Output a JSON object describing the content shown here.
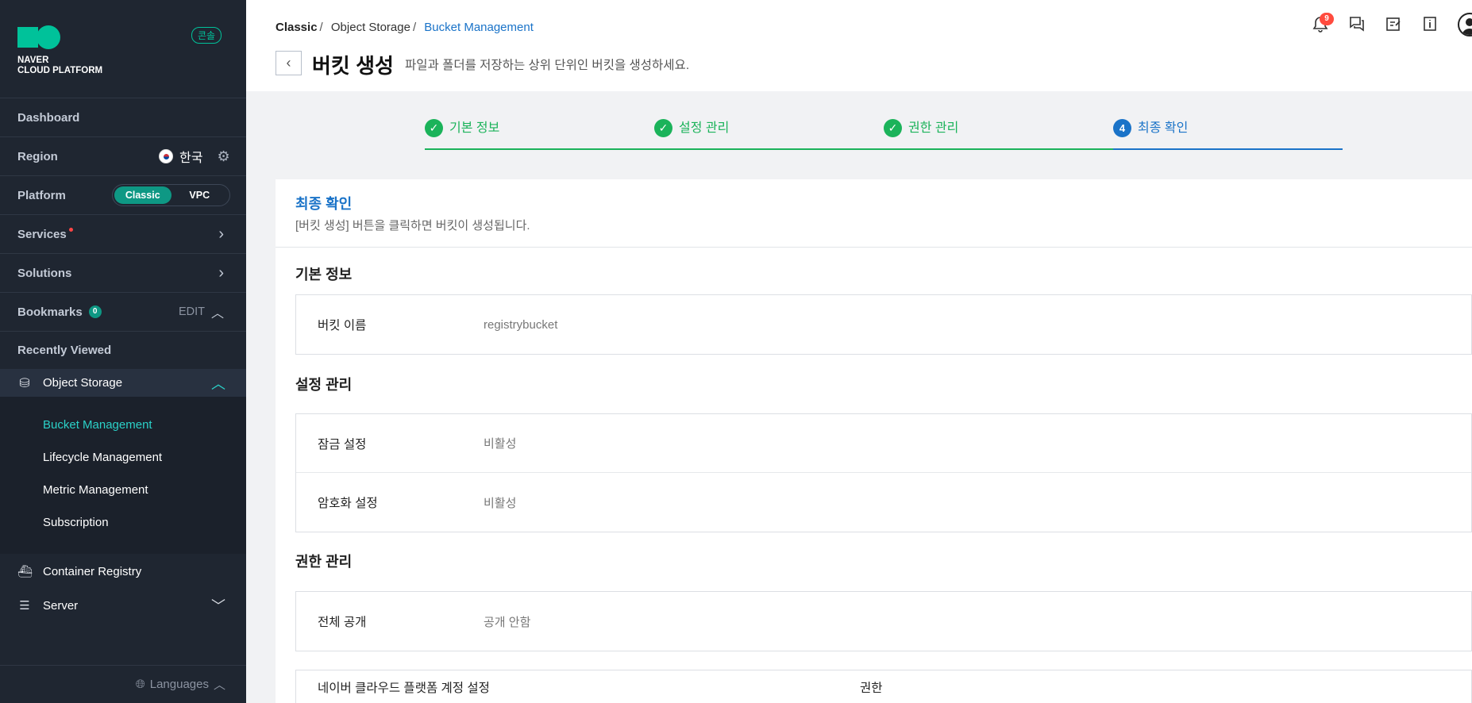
{
  "sidebar": {
    "logo_line1": "NAVER",
    "logo_line2": "CLOUD PLATFORM",
    "console_badge": "콘솔",
    "dashboard": "Dashboard",
    "region_label": "Region",
    "region_value": "한국",
    "platform_label": "Platform",
    "platform_options": [
      "Classic",
      "VPC"
    ],
    "platform_selected": "Classic",
    "services": "Services",
    "solutions": "Solutions",
    "bookmarks": "Bookmarks",
    "bookmarks_count": "0",
    "bookmarks_edit": "EDIT",
    "recently_viewed": "Recently Viewed",
    "object_storage": "Object Storage",
    "submenu": [
      "Bucket Management",
      "Lifecycle Management",
      "Metric Management",
      "Subscription"
    ],
    "container_registry": "Container Registry",
    "server": "Server",
    "languages": "Languages"
  },
  "header": {
    "breadcrumb": [
      "Classic",
      "Object Storage",
      "Bucket Management"
    ],
    "title": "버킷 생성",
    "subtitle": "파일과 폴더를 저장하는 상위 단위인 버킷을 생성하세요.",
    "notification_count": "9"
  },
  "stepper": {
    "steps": [
      {
        "label": "기본 정보",
        "status": "done"
      },
      {
        "label": "설정 관리",
        "status": "done"
      },
      {
        "label": "권한 관리",
        "status": "done"
      },
      {
        "label": "최종 확인",
        "status": "current",
        "number": "4"
      }
    ]
  },
  "card": {
    "title": "최종 확인",
    "desc": "[버킷 생성] 버튼을 클릭하면 버킷이 생성됩니다.",
    "basic_title": "기본 정보",
    "bucket_name_key": "버킷 이름",
    "bucket_name_val": "registrybucket",
    "settings_title": "설정 관리",
    "lock_key": "잠금 설정",
    "lock_val": "비활성",
    "encrypt_key": "암호화 설정",
    "encrypt_val": "비활성",
    "perm_title": "권한 관리",
    "public_key": "전체 공개",
    "public_val": "공개 안함",
    "table_col1": "네이버 클라우드 플랫폼 계정 설정",
    "table_col2": "권한"
  },
  "colors": {
    "sidebar_bg": "#1f2631",
    "accent_teal": "#00c29a",
    "step_done": "#1bb35a",
    "step_current": "#1a73c8"
  }
}
